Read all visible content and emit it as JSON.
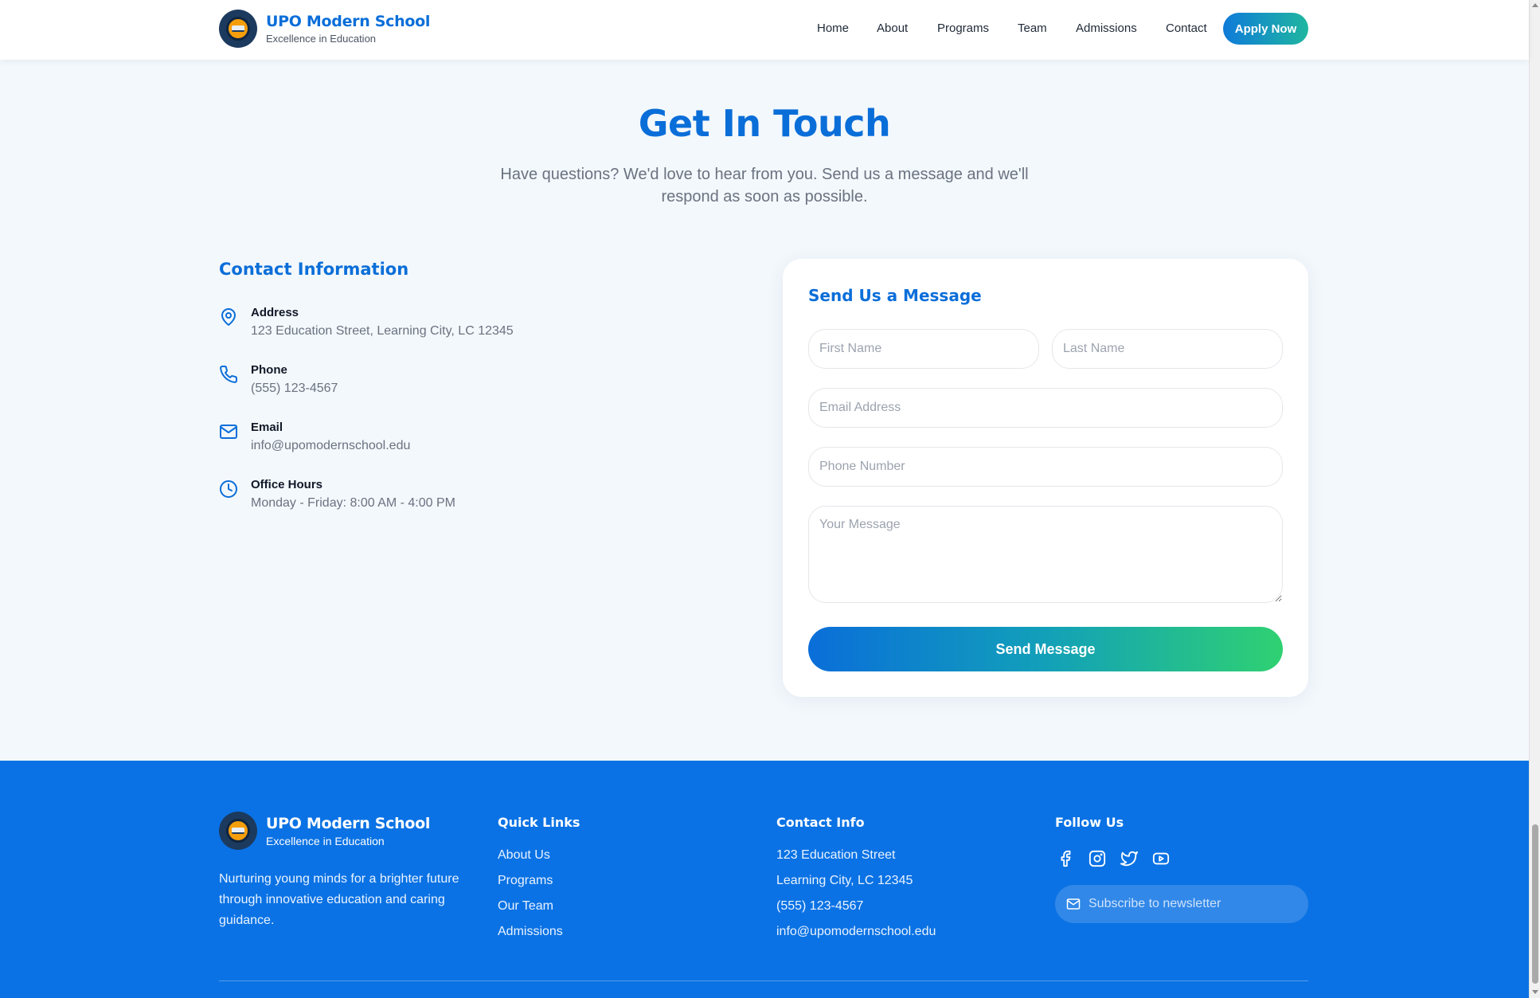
{
  "brand": {
    "name": "UPO Modern School",
    "tagline": "Excellence in Education"
  },
  "nav": {
    "items": [
      "Home",
      "About",
      "Programs",
      "Team",
      "Admissions",
      "Contact"
    ],
    "cta": "Apply Now"
  },
  "hero": {
    "title": "Get In Touch",
    "subtitle": "Have questions? We'd love to hear from you. Send us a message and we'll respond as soon as possible."
  },
  "contact_info": {
    "title": "Contact Information",
    "items": [
      {
        "icon": "map-pin-icon",
        "label": "Address",
        "value": "123 Education Street, Learning City, LC 12345"
      },
      {
        "icon": "phone-icon",
        "label": "Phone",
        "value": "(555) 123-4567"
      },
      {
        "icon": "mail-icon",
        "label": "Email",
        "value": "info@upomodernschool.edu"
      },
      {
        "icon": "clock-icon",
        "label": "Office Hours",
        "value": "Monday - Friday: 8:00 AM - 4:00 PM"
      }
    ]
  },
  "form": {
    "title": "Send Us a Message",
    "first_name": {
      "placeholder": "First Name",
      "value": ""
    },
    "last_name": {
      "placeholder": "Last Name",
      "value": ""
    },
    "email": {
      "placeholder": "Email Address",
      "value": ""
    },
    "phone": {
      "placeholder": "Phone Number",
      "value": ""
    },
    "message": {
      "placeholder": "Your Message",
      "value": ""
    },
    "submit": "Send Message"
  },
  "footer": {
    "about": "Nurturing young minds for a brighter future through innovative education and caring guidance.",
    "quick_links": {
      "title": "Quick Links",
      "items": [
        "About Us",
        "Programs",
        "Our Team",
        "Admissions"
      ]
    },
    "contact": {
      "title": "Contact Info",
      "items": [
        "123 Education Street",
        "Learning City, LC 12345",
        "(555) 123-4567",
        "info@upomodernschool.edu"
      ]
    },
    "follow": {
      "title": "Follow Us",
      "icons": [
        "facebook-icon",
        "instagram-icon",
        "twitter-icon",
        "youtube-icon"
      ]
    },
    "newsletter": {
      "placeholder": "Subscribe to newsletter",
      "value": ""
    }
  },
  "colors": {
    "primary": "#0a6ed9",
    "footer_bg": "#0a72e4",
    "accent_green": "#2fd172",
    "page_bg": "#f3f8fc"
  }
}
